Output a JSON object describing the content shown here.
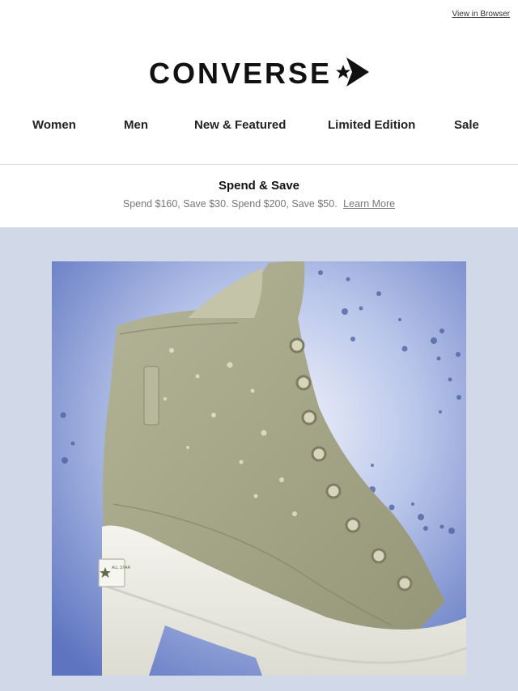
{
  "topbar": {
    "view_in_browser": "View in Browser"
  },
  "brand": {
    "name": "CONVERSE",
    "mark_icon": "star-chevron-icon"
  },
  "nav": {
    "items": [
      {
        "label": "Women"
      },
      {
        "label": "Men"
      },
      {
        "label": "New & Featured"
      },
      {
        "label": "Limited Edition"
      },
      {
        "label": "Sale"
      }
    ]
  },
  "promo": {
    "title": "Spend & Save",
    "text": "Spend $160, Save $30. Spend $200, Save $50.",
    "link": "Learn More"
  },
  "hero": {
    "heel_label": "ALL STAR",
    "colors": {
      "background": "#d1d9e8",
      "shoe": "#a5a688",
      "sole": "#eeeee6",
      "sky": "#6d83c8"
    }
  }
}
